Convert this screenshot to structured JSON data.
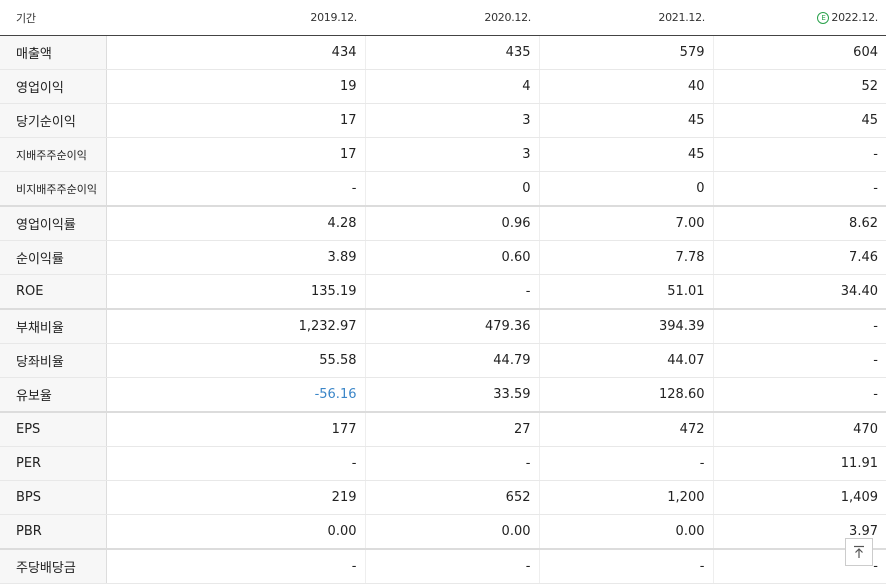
{
  "header": {
    "period_label": "기간",
    "columns": [
      {
        "label": "2019.12.",
        "estimate": false
      },
      {
        "label": "2020.12.",
        "estimate": false
      },
      {
        "label": "2021.12.",
        "estimate": false
      },
      {
        "label": "2022.12.",
        "estimate": true,
        "estimate_mark": "E"
      }
    ]
  },
  "rows": [
    {
      "label": "매출액",
      "values": [
        "434",
        "435",
        "579",
        "604"
      ]
    },
    {
      "label": "영업이익",
      "values": [
        "19",
        "4",
        "40",
        "52"
      ]
    },
    {
      "label": "당기순이익",
      "values": [
        "17",
        "3",
        "45",
        "45"
      ]
    },
    {
      "label": "지배주주순이익",
      "values": [
        "17",
        "3",
        "45",
        "-"
      ]
    },
    {
      "label": "비지배주주순이익",
      "values": [
        "-",
        "0",
        "0",
        "-"
      ]
    },
    {
      "label": "영업이익률",
      "values": [
        "4.28",
        "0.96",
        "7.00",
        "8.62"
      ]
    },
    {
      "label": "순이익률",
      "values": [
        "3.89",
        "0.60",
        "7.78",
        "7.46"
      ]
    },
    {
      "label": "ROE",
      "values": [
        "135.19",
        "-",
        "51.01",
        "34.40"
      ]
    },
    {
      "label": "부채비율",
      "values": [
        "1,232.97",
        "479.36",
        "394.39",
        "-"
      ]
    },
    {
      "label": "당좌비율",
      "values": [
        "55.58",
        "44.79",
        "44.07",
        "-"
      ]
    },
    {
      "label": "유보율",
      "values": [
        "-56.16",
        "33.59",
        "128.60",
        "-"
      ]
    },
    {
      "label": "EPS",
      "values": [
        "177",
        "27",
        "472",
        "470"
      ]
    },
    {
      "label": "PER",
      "values": [
        "-",
        "-",
        "-",
        "11.91"
      ]
    },
    {
      "label": "BPS",
      "values": [
        "219",
        "652",
        "1,200",
        "1,409"
      ]
    },
    {
      "label": "PBR",
      "values": [
        "0.00",
        "0.00",
        "0.00",
        "3.97"
      ]
    },
    {
      "label": "주당배당금",
      "values": [
        "-",
        "-",
        "-",
        "-"
      ]
    }
  ],
  "colors": {
    "negative": "#3b86c8",
    "estimate": "#2ba24c"
  },
  "scroll_top_icon": "arrow-up-to-top-icon"
}
